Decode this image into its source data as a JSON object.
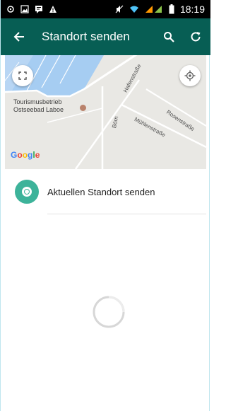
{
  "status_bar": {
    "time": "18:19",
    "icons": [
      "location-icon",
      "image-icon",
      "message-icon",
      "warning-icon",
      "mute-icon",
      "wifi-icon",
      "signal-icon",
      "battery-icon"
    ]
  },
  "app_bar": {
    "title": "Standort senden",
    "icons": [
      "back-arrow-icon",
      "search-icon",
      "refresh-icon"
    ],
    "color": "#075e54"
  },
  "map": {
    "poi_line1": "Tourismusbetrieb",
    "poi_line2": "Ostseebad Laboe",
    "streets": [
      "Hafenstraße",
      "Börn",
      "Mühlenstraße",
      "Rosenstraße"
    ],
    "logo": "Google",
    "water_color": "#a6cdf2",
    "land_color": "#e9e8e4"
  },
  "send_location": {
    "label": "Aktuellen Standort senden",
    "icon": "location-dot-icon",
    "icon_color": "#3db39a"
  }
}
